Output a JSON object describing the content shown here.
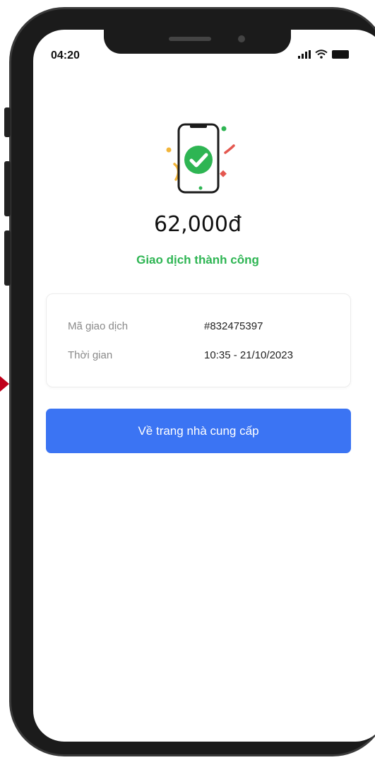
{
  "status_bar": {
    "time": "04:20"
  },
  "transaction": {
    "amount": "62,000đ",
    "status": "Giao dịch thành công",
    "details": [
      {
        "label": "Mã giao dịch",
        "value": "#832475397"
      },
      {
        "label": "Thời gian",
        "value": "10:35 - 21/10/2023"
      }
    ]
  },
  "actions": {
    "return_label": "Về trang nhà cung cấp"
  },
  "colors": {
    "accent": "#3b74f3",
    "success": "#2eb553"
  },
  "icons": [
    "signal-icon",
    "wifi-icon",
    "battery-icon",
    "success-phone-icon",
    "checkmark-icon"
  ]
}
